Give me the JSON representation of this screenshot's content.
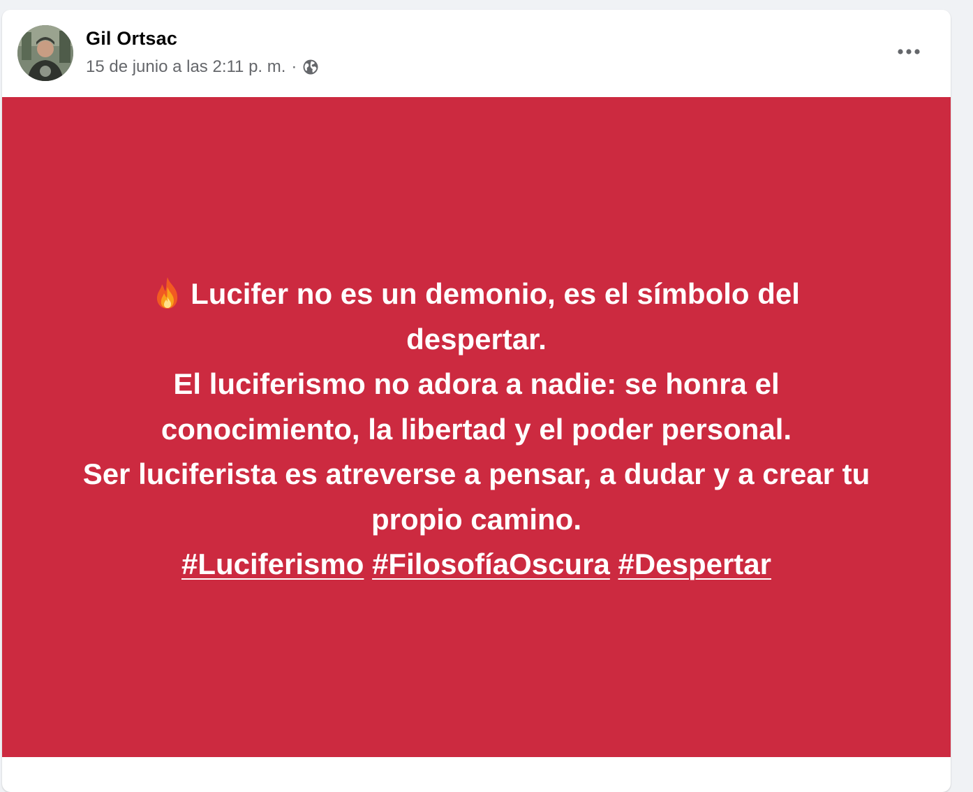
{
  "post": {
    "author": "Gil Ortsac",
    "timestamp": "15 de junio a las 2:11 p. m.",
    "separator": "·",
    "privacy_icon": "globe-icon",
    "more_icon": "ellipsis-icon",
    "background_color": "#cc2a40",
    "text_color": "#ffffff",
    "lead_icon": "fire-icon",
    "lines": [
      "Lucifer no es un demonio, es el símbolo del",
      "despertar.",
      "El luciferismo no adora a nadie: se honra el",
      "conocimiento, la libertad y el poder personal.",
      "Ser luciferista es atreverse a pensar, a dudar y a crear tu",
      "propio camino."
    ],
    "hashtags": [
      "#Luciferismo",
      "#FilosofíaOscura",
      "#Despertar"
    ]
  }
}
